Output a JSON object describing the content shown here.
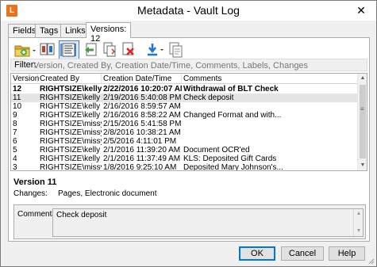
{
  "window": {
    "title": "Metadata - Vault Log",
    "app_icon_letter": "L",
    "close_glyph": "✕"
  },
  "tabs": [
    {
      "label": "Fields"
    },
    {
      "label": "Tags"
    },
    {
      "label": "Links"
    },
    {
      "label": "Versions: 12"
    }
  ],
  "toolbar": {
    "icons": [
      "open-folder-icon",
      "compare-icon",
      "text-view-icon",
      "restore-icon",
      "copy-icon",
      "delete-icon",
      "download-icon",
      "duplicate-icon"
    ]
  },
  "filter": {
    "label": "Filter:",
    "placeholder": "Version, Created By, Creation Date/Time, Comments, Labels, Changes"
  },
  "table": {
    "columns": [
      "Version",
      "Created By",
      "Creation Date/Time",
      "Comments"
    ],
    "rows": [
      {
        "version": "12",
        "created_by": "RIGHTSIZE\\kelly",
        "date": "2/22/2016 10:20:07 AM",
        "comments": "Withdrawal of BLT Check",
        "bold": true
      },
      {
        "version": "11",
        "created_by": "RIGHTSIZE\\kelly",
        "date": "2/19/2016 5:40:08 PM",
        "comments": "Check deposit",
        "selected": true
      },
      {
        "version": "10",
        "created_by": "RIGHTSIZE\\kelly",
        "date": "2/16/2016 8:59:57 AM",
        "comments": ""
      },
      {
        "version": "9",
        "created_by": "RIGHTSIZE\\kelly",
        "date": "2/16/2016 8:58:22 AM",
        "comments": "Changed Format and with..."
      },
      {
        "version": "8",
        "created_by": "RIGHTSIZE\\missy",
        "date": "2/15/2016 5:41:58 PM",
        "comments": ""
      },
      {
        "version": "7",
        "created_by": "RIGHTSIZE\\missy",
        "date": "2/8/2016 10:38:21 AM",
        "comments": ""
      },
      {
        "version": "6",
        "created_by": "RIGHTSIZE\\missy",
        "date": "2/5/2016 4:11:01 PM",
        "comments": ""
      },
      {
        "version": "5",
        "created_by": "RIGHTSIZE\\kelly",
        "date": "2/1/2016 11:39:20 AM",
        "comments": "Document OCR'ed"
      },
      {
        "version": "4",
        "created_by": "RIGHTSIZE\\kelly",
        "date": "2/1/2016 11:37:49 AM",
        "comments": "KLS: Deposited Gift Cards"
      },
      {
        "version": "3",
        "created_by": "RIGHTSIZE\\missy",
        "date": "1/8/2016 9:25:10 AM",
        "comments": "Deposited Mary Johnson's..."
      }
    ]
  },
  "details": {
    "version_title": "Version 11",
    "changes_label": "Changes:",
    "changes_value": "Pages, Electronic document",
    "comments_label": "Comments:",
    "comments_value": "Check deposit"
  },
  "buttons": {
    "ok": "OK",
    "cancel": "Cancel",
    "help": "Help"
  },
  "colors": {
    "app_icon": "#e8731c",
    "default_button_border": "#0078d7",
    "selected_row": "#e5e5e5"
  }
}
